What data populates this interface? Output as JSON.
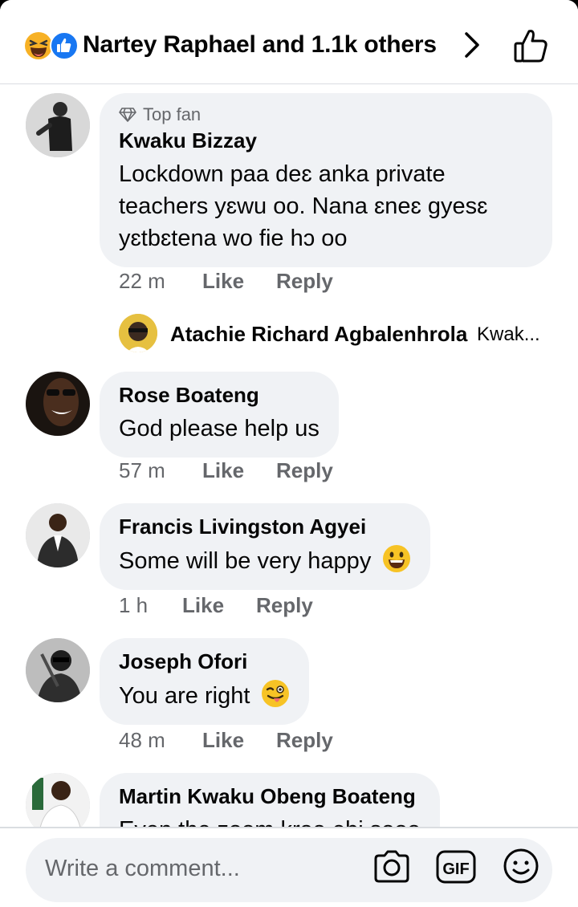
{
  "header": {
    "reactions": [
      "laughing-face-icon",
      "like-thumb-icon"
    ],
    "title": "Nartey Raphael and 1.1k others"
  },
  "comments": [
    {
      "badge": "Top fan",
      "name": "Kwaku Bizzay",
      "lines": [
        "Lockdown paa deɛ anka private",
        "teachers yɛwu oo. Nana ɛneɛ gyesɛ",
        "yɛtbɛtena wo fie hɔ oo"
      ],
      "time": "22 m",
      "like": "Like",
      "reply": "Reply",
      "reply_preview": {
        "name": "Atachie Richard Agbalenhrola",
        "text": "Kwak..."
      }
    },
    {
      "name": "Rose Boateng",
      "text": "God please help us",
      "time": "57 m",
      "like": "Like",
      "reply": "Reply"
    },
    {
      "name": "Francis Livingston Agyei",
      "text": "Some will be very happy",
      "emoji": "grinning-face-icon",
      "time": "1 h",
      "like": "Like",
      "reply": "Reply"
    },
    {
      "name": "Joseph Ofori",
      "text": "You are right",
      "emoji": "winking-tongue-face-icon",
      "time": "48 m",
      "like": "Like",
      "reply": "Reply"
    },
    {
      "name": "Martin Kwaku Obeng Boateng",
      "text": "Even the zoom kraa ebi sooo"
    }
  ],
  "composer": {
    "placeholder": "Write a comment...",
    "icons": [
      "camera-icon",
      "gif-icon",
      "emoji-icon"
    ],
    "gif_label": "GIF"
  },
  "colors": {
    "bubble": "#f0f2f5",
    "secondary_text": "#65676b",
    "primary_text": "#050505",
    "like_blue": "#1877f2"
  }
}
